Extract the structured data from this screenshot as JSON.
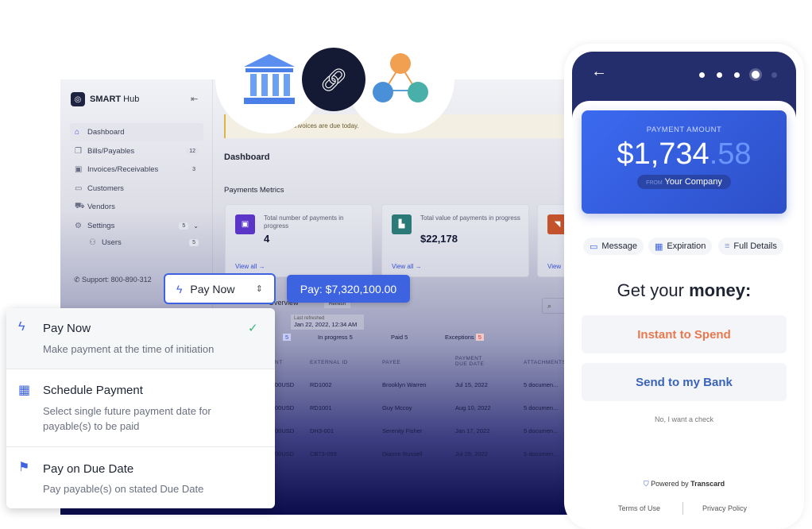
{
  "app": {
    "brand_bold": "SMART",
    "brand_rest": " Hub"
  },
  "sidebar": {
    "items": [
      {
        "label": "Dashboard",
        "icon": "home-icon",
        "glyph": "⌂"
      },
      {
        "label": "Bills/Payables",
        "icon": "copy-icon",
        "glyph": "❐",
        "badge": "12"
      },
      {
        "label": "Invoices/Receivables",
        "icon": "invoice-icon",
        "glyph": "▣",
        "badge": "3"
      },
      {
        "label": "Customers",
        "icon": "briefcase-icon",
        "glyph": "▭"
      },
      {
        "label": "Vendors",
        "icon": "truck-icon",
        "glyph": "⛟"
      },
      {
        "label": "Settings",
        "icon": "gear-icon",
        "glyph": "⚙",
        "badge": "5"
      },
      {
        "label": "Users",
        "icon": "users-icon",
        "glyph": "⚇",
        "badge": "5"
      }
    ],
    "support": "Support: 800-890-312"
  },
  "alert": {
    "text": "invoices are due today."
  },
  "main": {
    "title": "Dashboard",
    "metrics_title": "Payments Metrics",
    "cards": [
      {
        "label": "Total number of payments in progress",
        "value": "4",
        "view": "View all →",
        "color": "#5a35c8"
      },
      {
        "label": "Total value of payments in progress",
        "value": "$22,178",
        "view": "View all →",
        "color": "#2b7a78"
      },
      {
        "label": "",
        "value": "",
        "view": "View",
        "color": "#c2532d"
      }
    ],
    "overview": "Overview",
    "refresh": "Refresh",
    "last_refreshed_label": "Last refreshed",
    "last_refreshed": "Jan 22, 2022, 12:34 AM",
    "tabs": [
      {
        "label": "y",
        "count": "5"
      },
      {
        "label": "In progress",
        "count": "5"
      },
      {
        "label": "Paid",
        "count": "5"
      },
      {
        "label": "Exceptions",
        "count": "5"
      }
    ],
    "columns": [
      "NT",
      "EXTERNAL ID",
      "PAYEE",
      "PAYMENT DUE DATE",
      "ATTACHMENTS"
    ],
    "rows": [
      [
        "00USD",
        "RD1002",
        "Brooklyn Warren",
        "Jul 15, 2022",
        "5 documen..."
      ],
      [
        "00USD",
        "RD1001",
        "Guy Mccoy",
        "Aug 10, 2022",
        "5 documen..."
      ],
      [
        "00USD",
        "DH3-001",
        "Serenity Fisher",
        "Jan 17, 2022",
        "5 documen..."
      ],
      [
        "00USD",
        "CB73-099",
        "Dianne Russell",
        "Jul 28, 2022",
        "5 documen..."
      ]
    ]
  },
  "pay_method": {
    "selected": "Pay Now",
    "pay_button": "Pay: $7,320,100.00",
    "options": [
      {
        "title": "Pay Now",
        "desc": "Make payment at the time of initiation",
        "icon": "lightning-icon",
        "selected": true
      },
      {
        "title": "Schedule Payment",
        "desc": "Select single future payment date for payable(s) to be paid",
        "icon": "calendar-icon"
      },
      {
        "title": "Pay on Due Date",
        "desc": "Pay payable(s) on stated Due Date",
        "icon": "flag-icon"
      }
    ]
  },
  "phone": {
    "amount_label": "PAYMENT AMOUNT",
    "amount_main": "$1,734",
    "amount_cents": ".58",
    "from_label": "FROM",
    "from": "Your Company",
    "chips": [
      "Message",
      "Expiration",
      "Full Details"
    ],
    "headline_pre": "Get your ",
    "headline_bold": "money:",
    "instant": "Instant to Spend",
    "bank": "Send to my Bank",
    "decline": "No, I want a check",
    "powered_pre": "Powered by ",
    "powered_brand": "Transcard",
    "terms": "Terms of Use",
    "privacy": "Privacy Policy",
    "colors": {
      "instant": "#e8784e",
      "bank": "#3a63b8"
    }
  }
}
